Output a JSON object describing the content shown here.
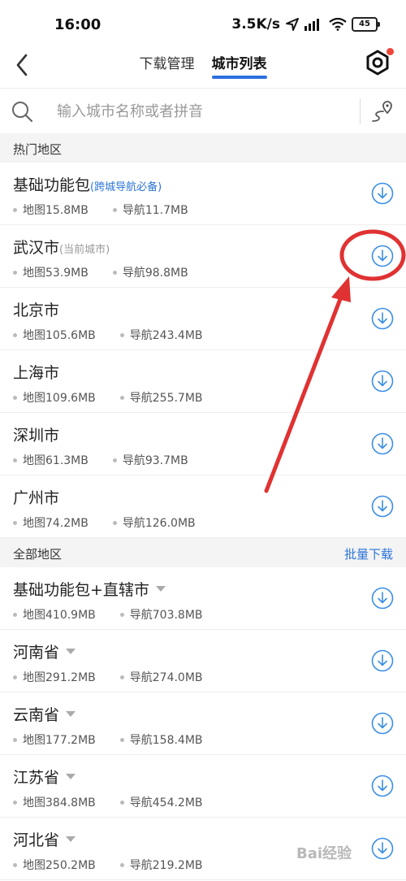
{
  "status": {
    "time": "16:00",
    "speed": "3.5K/s",
    "battery": "45"
  },
  "nav": {
    "tabs": [
      {
        "label": "下载管理",
        "active": false
      },
      {
        "label": "城市列表",
        "active": true
      }
    ]
  },
  "search": {
    "placeholder": "输入城市名称或者拼音"
  },
  "hot": {
    "title": "热门地区",
    "items": [
      {
        "name": "基础功能包",
        "tag": "(跨城导航必备)",
        "map": "地图15.8MB",
        "nav": "导航11.7MB"
      },
      {
        "name": "武汉市",
        "tag": "(当前城市)",
        "map": "地图53.9MB",
        "nav": "导航98.8MB"
      },
      {
        "name": "北京市",
        "map": "地图105.6MB",
        "nav": "导航243.4MB"
      },
      {
        "name": "上海市",
        "map": "地图109.6MB",
        "nav": "导航255.7MB"
      },
      {
        "name": "深圳市",
        "map": "地图61.3MB",
        "nav": "导航93.7MB"
      },
      {
        "name": "广州市",
        "map": "地图74.2MB",
        "nav": "导航126.0MB"
      }
    ]
  },
  "all": {
    "title": "全部地区",
    "batch_label": "批量下载",
    "items": [
      {
        "name": "基础功能包+直辖市",
        "map": "地图410.9MB",
        "nav": "导航703.8MB"
      },
      {
        "name": "河南省",
        "map": "地图291.2MB",
        "nav": "导航274.0MB"
      },
      {
        "name": "云南省",
        "map": "地图177.2MB",
        "nav": "导航158.4MB"
      },
      {
        "name": "江苏省",
        "map": "地图384.8MB",
        "nav": "导航454.2MB"
      },
      {
        "name": "河北省",
        "map": "地图250.2MB",
        "nav": "导航219.2MB"
      }
    ]
  },
  "watermark": "Bai经验",
  "colors": {
    "accent": "#2b6fe0",
    "link": "#2b74d8",
    "download_icon": "#3a8ee6",
    "annotation": "#e03232"
  },
  "icons": [
    "back-icon",
    "settings-icon",
    "search-icon",
    "route-icon",
    "download-icon"
  ]
}
